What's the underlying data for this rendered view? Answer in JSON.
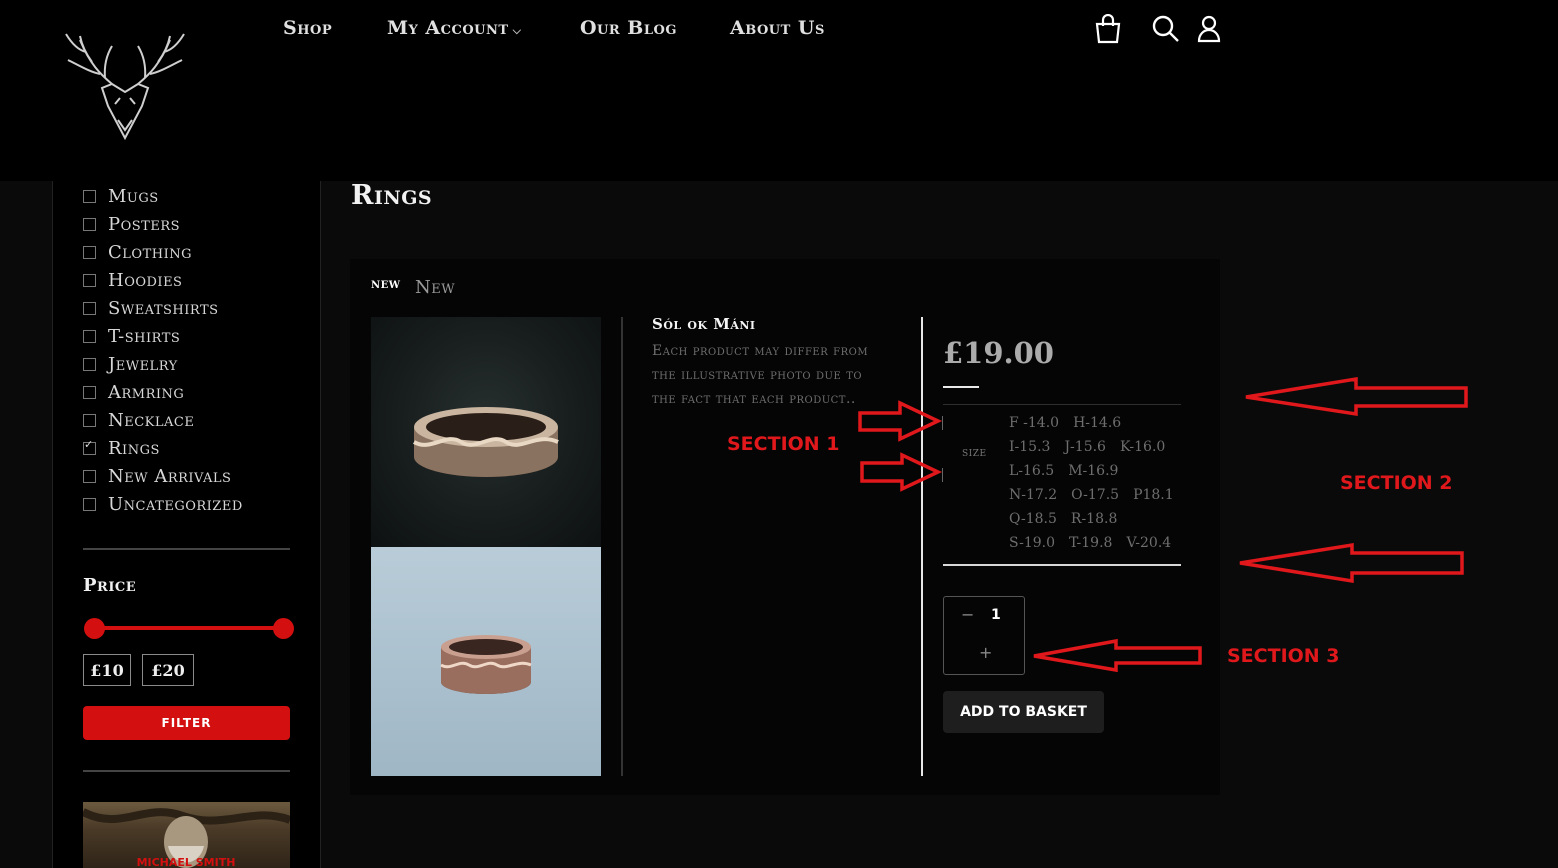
{
  "header": {
    "nav": {
      "shop": "Shop",
      "account": "My Account",
      "blog": "Our Blog",
      "about": "About Us"
    },
    "icons": [
      "basket-icon",
      "search-icon",
      "user-icon"
    ]
  },
  "sidebar": {
    "categories": [
      {
        "label": "Mugs",
        "checked": false
      },
      {
        "label": "Posters",
        "checked": false
      },
      {
        "label": "Clothing",
        "checked": false
      },
      {
        "label": "Hoodies",
        "checked": false
      },
      {
        "label": "Sweatshirts",
        "checked": false
      },
      {
        "label": "T-shirts",
        "checked": false
      },
      {
        "label": "Jewelry",
        "checked": false
      },
      {
        "label": "Armring",
        "checked": false
      },
      {
        "label": "Necklace",
        "checked": false
      },
      {
        "label": "Rings",
        "checked": true
      },
      {
        "label": "New Arrivals",
        "checked": false
      },
      {
        "label": "Uncategorized",
        "checked": false
      }
    ],
    "price": {
      "title": "Price",
      "min": "£10",
      "max": "£20",
      "filter_label": "FILTER"
    },
    "promo_text": "MICHAEL SMITH"
  },
  "main": {
    "title": "Rings",
    "badge": "new",
    "badge_secondary": "New",
    "product": {
      "name": "Sól ok Máni",
      "description": "Each product may differ from the illustrative photo due to the fact that each product..",
      "price": "£19.00",
      "size_label": "size",
      "sizes": [
        [
          "F -14.0",
          "H-14.6"
        ],
        [
          "I-15.3",
          "J-15.6",
          "K-16.0"
        ],
        [
          "L-16.5",
          "M-16.9"
        ],
        [
          "N-17.2",
          "O-17.5",
          "P18.1"
        ],
        [
          "Q-18.5",
          "R-18.8"
        ],
        [
          "S-19.0",
          "T-19.8",
          "V-20.4"
        ]
      ],
      "quantity": "1",
      "qty_minus": "−",
      "qty_plus": "+",
      "add_to_basket": "ADD TO BASKET"
    }
  },
  "annotations": {
    "section1": "SECTION 1",
    "section2": "SECTION 2",
    "section3": "SECTION 3",
    "color": "#e0181c"
  }
}
